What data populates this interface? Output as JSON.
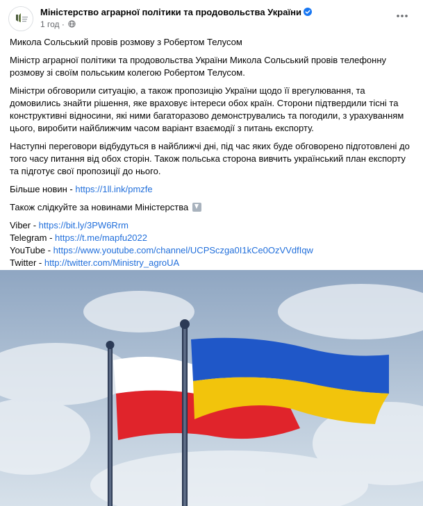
{
  "post": {
    "page_name": "Міністерство аграрної політики та продовольства України",
    "time": "1 год",
    "separator": "·",
    "title_line": "Микола Сольський провів розмову з Робертом Телусом",
    "paragraphs": [
      "Міністр аграрної політики та продовольства України Микола Сольський провів телефонну розмову зі своїм польським колегою Робертом Телусом.",
      "Міністри обговорили ситуацію, а також пропозицію України щодо її врегулювання, та домовились знайти рішення, яке враховує інтереси обох країн. Сторони підтвердили тісні та конструктивні відносини, які ними багаторазово демонструвались та погодили, з урахуванням цього, виробити найближчим часом варіант взаємодії з питань експорту.",
      "Наступні переговори відбудуться в найближчі дні, під час яких  буде обговорено підготовлені до того часу питання від обох сторін. Також польська сторона вивчить український план експорту та підготує свої пропозиції до нього."
    ],
    "more_news_label": "Більше новин - ",
    "more_news_link": "https://1ll.ink/pmzfe",
    "follow_text": "Також слідкуйте за новинами Міністерства",
    "follow_emoji": "down-arrow-emoji",
    "links": [
      {
        "label": "Viber - ",
        "url": "https://bit.ly/3PW6Rrm"
      },
      {
        "label": "Telegram - ",
        "url": "https://t.me/mapfu2022"
      },
      {
        "label": "YouTube - ",
        "url": "https://www.youtube.com/channel/UCPSczga0I1kCe0OzVVdfIqw"
      },
      {
        "label": "Twitter - ",
        "url": "http://twitter.com/Ministry_agroUA"
      }
    ]
  },
  "colors": {
    "link": "#216fdb",
    "secondary_text": "#65676b",
    "verified_badge": "#1877f2",
    "flag_ukraine_blue": "#1f57c8",
    "flag_ukraine_yellow": "#f2c40c",
    "flag_poland_red": "#e0242b"
  },
  "icons": {
    "verified": "verified-badge-icon",
    "audience": "globe-icon",
    "menu": "more-options-icon"
  }
}
